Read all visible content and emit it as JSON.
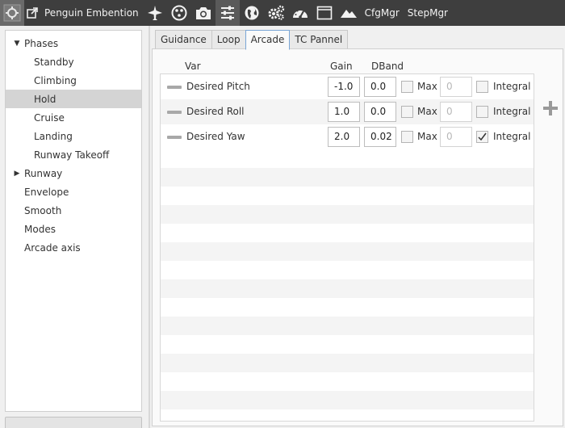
{
  "toolbar": {
    "app_title": "Penguin Embention",
    "cfgmgr_label": "CfgMgr",
    "stepmgr_label": "StepMgr"
  },
  "tree": {
    "items": [
      {
        "label": "Phases",
        "expanded": true
      },
      {
        "label": "Standby"
      },
      {
        "label": "Climbing"
      },
      {
        "label": "Hold",
        "selected": true
      },
      {
        "label": "Cruise"
      },
      {
        "label": "Landing"
      },
      {
        "label": "Runway Takeoff"
      },
      {
        "label": "Runway",
        "expanded": false
      },
      {
        "label": "Envelope"
      },
      {
        "label": "Smooth"
      },
      {
        "label": "Modes"
      },
      {
        "label": "Arcade axis"
      }
    ]
  },
  "add_button": {
    "label": "Add"
  },
  "tabs": [
    {
      "label": "Guidance"
    },
    {
      "label": "Loop"
    },
    {
      "label": "Arcade",
      "active": true
    },
    {
      "label": "TC Pannel"
    }
  ],
  "table": {
    "headers": {
      "var": "Var",
      "gain": "Gain",
      "dband": "DBand"
    },
    "max_label": "Max",
    "integral_label": "Integral",
    "rows": [
      {
        "name": "Desired Pitch",
        "gain": "-1.0",
        "dband": "0.0",
        "max_checked": false,
        "max_value": "0",
        "integral_checked": false
      },
      {
        "name": "Desired Roll",
        "gain": "1.0",
        "dband": "0.0",
        "max_checked": false,
        "max_value": "0",
        "integral_checked": false
      },
      {
        "name": "Desired Yaw",
        "gain": "2.0",
        "dband": "0.02",
        "max_checked": false,
        "max_value": "0",
        "integral_checked": true
      }
    ]
  },
  "colors": {
    "toolbar_bg": "#3e3e3e",
    "active_tab_border": "#7aa6d6",
    "selected_item": "#d4d4d4"
  }
}
